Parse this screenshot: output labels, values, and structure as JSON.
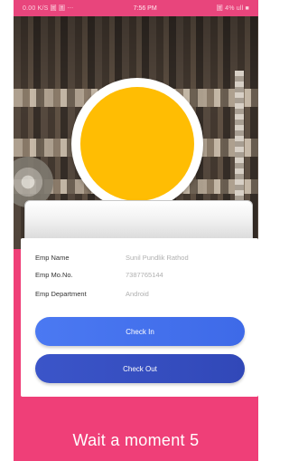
{
  "status_bar": {
    "left": "0.00 K/S 圖 圖 ⋯",
    "time": "7:56 PM",
    "right": "圖 4% ull ■"
  },
  "employee": {
    "name_label": "Emp Name",
    "name_value": "Sunil Pundlik Rathod",
    "mobile_label": "Emp Mo.No.",
    "mobile_value": "7387765144",
    "department_label": "Emp Department",
    "department_value": "Android"
  },
  "actions": {
    "check_in": "Check In",
    "check_out": "Check Out"
  },
  "footer": {
    "wait_text": "Wait a moment 5"
  },
  "colors": {
    "accent_pink": "#ef3f78",
    "avatar": "#ffbd03",
    "check_in": "#4b79f2",
    "check_out": "#3b55c9"
  }
}
